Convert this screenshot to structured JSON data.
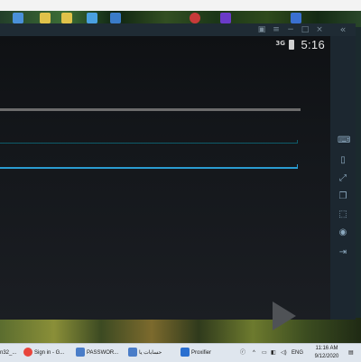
{
  "emulator": {
    "status_time": "5:16",
    "network_label": "3G",
    "titlebar_icons": [
      "keyboard-icon",
      "menu-icon",
      "minimize-icon",
      "restore-icon",
      "close-icon"
    ],
    "collapse_symbol": "«",
    "sidebar_icons": [
      "keyboard-icon",
      "shake-icon",
      "fullscreen-icon",
      "multi-window-icon",
      "screenshot-icon",
      "record-icon",
      "exit-icon"
    ]
  },
  "taskbar": {
    "items": [
      {
        "label": "n32_..."
      },
      {
        "label": "Sign in - G..."
      },
      {
        "label": "PASSWOR..."
      },
      {
        "label": "حسابات يا"
      },
      {
        "label": "Proxifier"
      }
    ],
    "tray_lang": "ENG",
    "clock_time": "11:16 AM",
    "clock_date": "9/12/2020"
  },
  "colors": {
    "accent_line": "#2a9bd0",
    "screen_bg": "#14171b"
  }
}
